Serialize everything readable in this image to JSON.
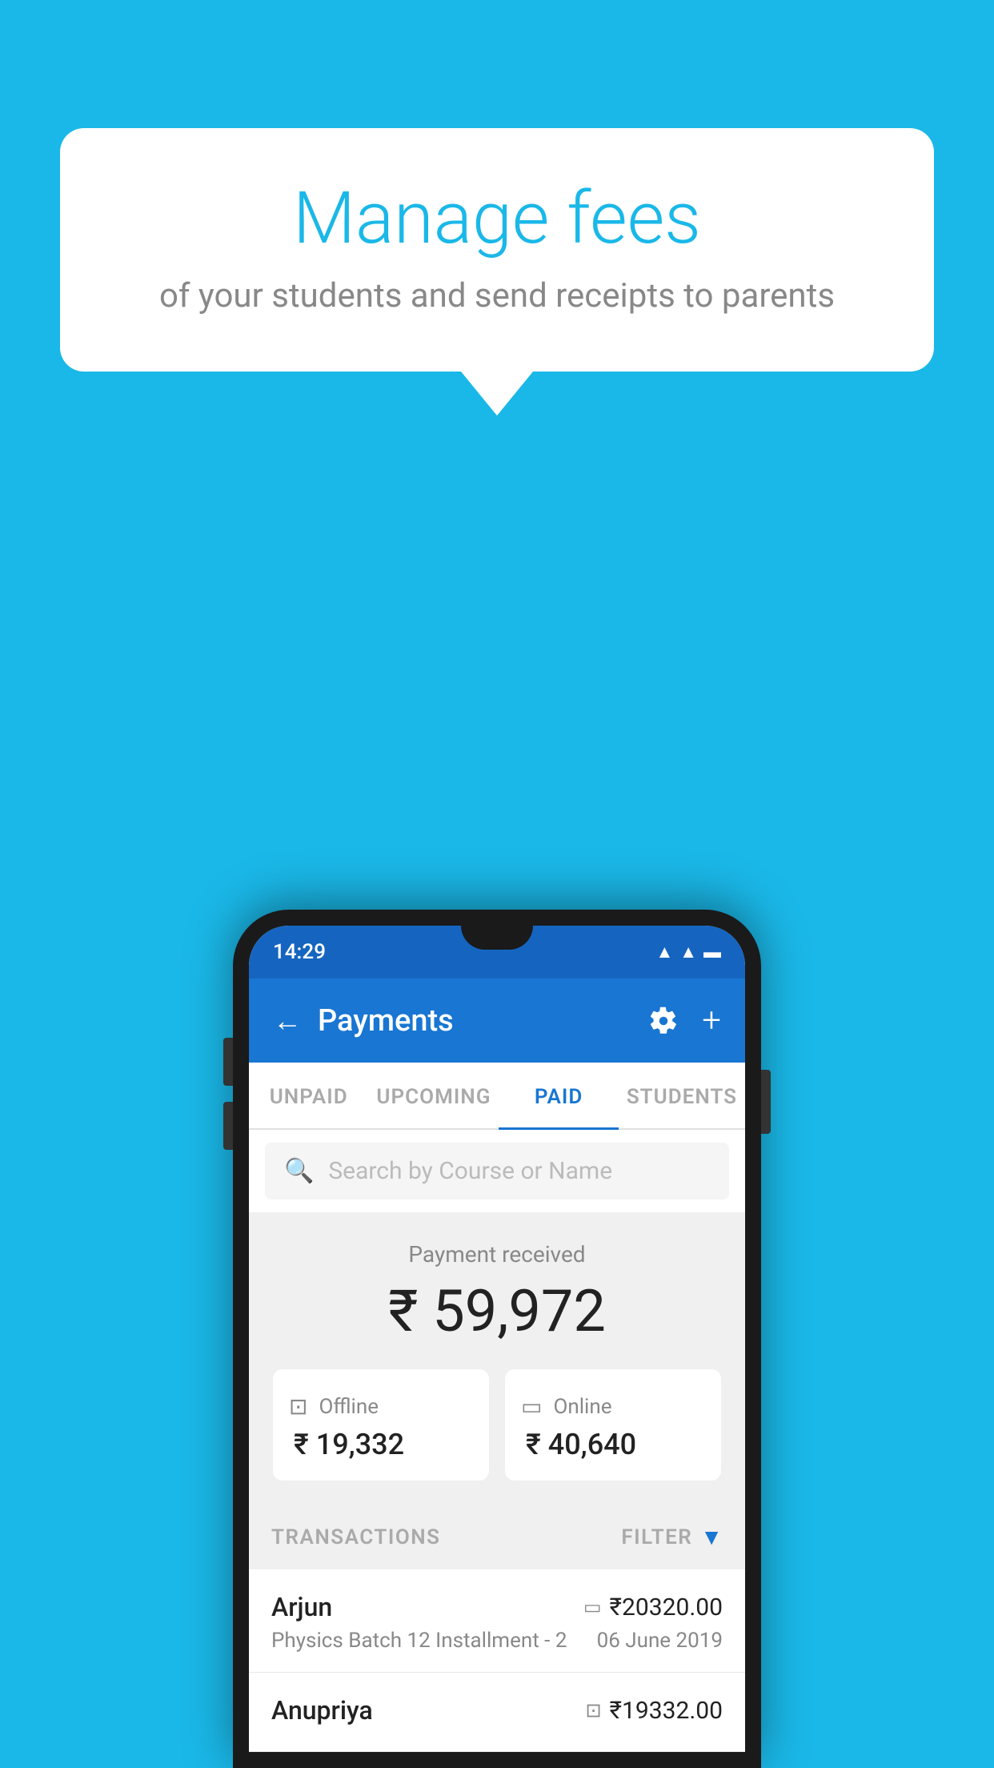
{
  "background_color": "#1ab8e8",
  "speech_bubble": {
    "title": "Manage fees",
    "subtitle": "of your students and send receipts to parents"
  },
  "status_bar": {
    "time": "14:29",
    "icons": [
      "wifi",
      "signal",
      "battery"
    ]
  },
  "app_bar": {
    "title": "Payments",
    "back_label": "←",
    "plus_label": "+"
  },
  "tabs": [
    {
      "label": "UNPAID",
      "active": false
    },
    {
      "label": "UPCOMING",
      "active": false
    },
    {
      "label": "PAID",
      "active": true
    },
    {
      "label": "STUDENTS",
      "active": false
    }
  ],
  "search": {
    "placeholder": "Search by Course or Name"
  },
  "payment_summary": {
    "label": "Payment received",
    "total": "₹ 59,972",
    "offline": {
      "label": "Offline",
      "amount": "₹ 19,332"
    },
    "online": {
      "label": "Online",
      "amount": "₹ 40,640"
    }
  },
  "transactions": {
    "header_label": "TRANSACTIONS",
    "filter_label": "FILTER",
    "items": [
      {
        "name": "Arjun",
        "amount": "₹20320.00",
        "course": "Physics Batch 12 Installment - 2",
        "date": "06 June 2019",
        "payment_type": "card"
      },
      {
        "name": "Anupriya",
        "amount": "₹19332.00",
        "course": "",
        "date": "",
        "payment_type": "offline"
      }
    ]
  }
}
